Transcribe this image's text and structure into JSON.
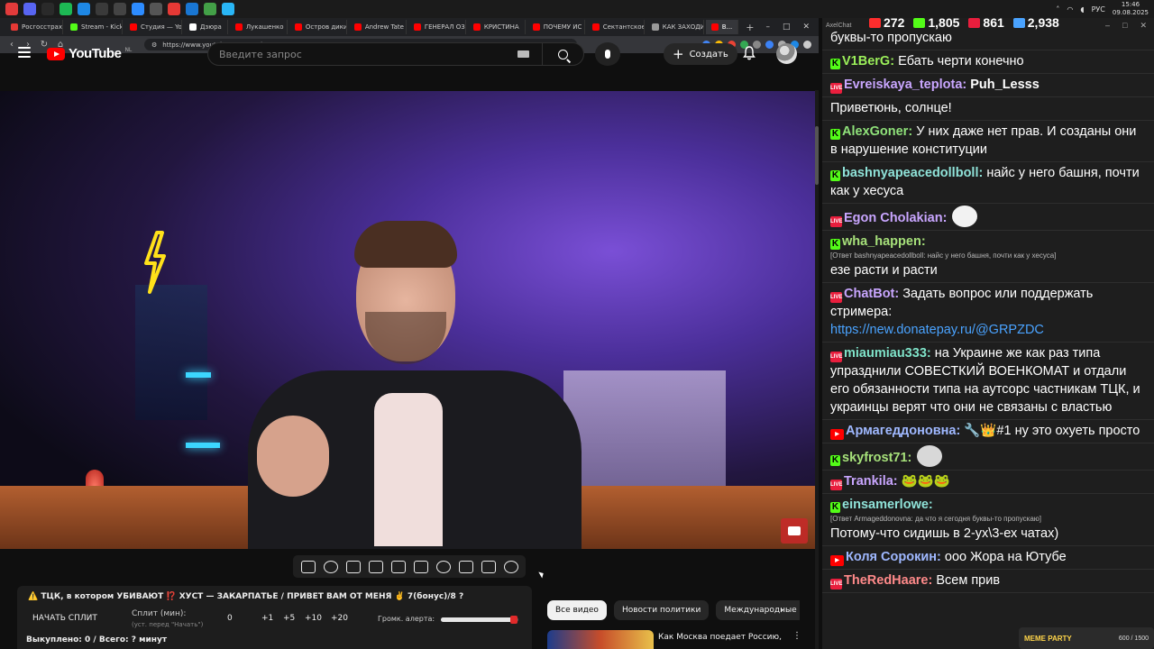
{
  "taskbar": {
    "lang": "РУС",
    "time": "15:46",
    "date": "09.08.2025",
    "icon_colors": [
      "#e23b3b",
      "#5865f2",
      "#2a2a2a",
      "#1db954",
      "#1e88e5",
      "#3a3a3a",
      "#444444",
      "#2d8cff",
      "#555555",
      "#e53935",
      "#1976d2",
      "#43a047",
      "#29b6f6"
    ]
  },
  "browser": {
    "tabs": [
      {
        "label": "Росгосстрах",
        "color": "#e53935"
      },
      {
        "label": "Stream - Kick",
        "color": "#53fc18"
      },
      {
        "label": "Студия — YouTube",
        "color": "#ff0000"
      },
      {
        "label": "Дзюра",
        "color": "#ffffff"
      },
      {
        "label": "Лукашенко",
        "color": "#ff0000"
      },
      {
        "label": "Остров дикий",
        "color": "#ff0000"
      },
      {
        "label": "Andrew Tate",
        "color": "#ff0000"
      },
      {
        "label": "ГЕНЕРАЛ ОЗ",
        "color": "#ff0000"
      },
      {
        "label": "КРИСТИНА",
        "color": "#ff0000"
      },
      {
        "label": "ПОЧЕМУ ИС",
        "color": "#ff0000"
      },
      {
        "label": "Сектантское",
        "color": "#ff0000"
      },
      {
        "label": "КАК ЗАХОДИ",
        "color": "#999999"
      },
      {
        "label": "В...",
        "color": "#ff0000"
      }
    ],
    "url": "https://www.youtube.com/watch?v=WAO4zZUwRc0"
  },
  "youtube": {
    "logo_word": "YouTube",
    "region": "NL",
    "search_placeholder": "Введите запрос",
    "create_label": "Создать"
  },
  "split": {
    "title": "⚠️ ТЦК, в котором УБИВАЮТ ⁉️ ХУСТ — ЗАКАРПАТЬЕ / ПРИВЕТ ВАМ ОТ МЕНЯ ✌️ 7(бонус)/8 ?",
    "start_label": "НАЧАТЬ СПЛИТ",
    "split_label": "Сплит (мин):",
    "split_sub": "(уст. перед \"Начать\")",
    "value": "0",
    "btn_plus1": "+1",
    "btn_plus5": "+5",
    "btn_plus10": "+10",
    "btn_plus20": "+20",
    "volume_label": "Громк. алерта:",
    "volume_fraction": 0.96,
    "footer": "Выкуплено: 0 / Всего: ? минут"
  },
  "chips": [
    "Все видео",
    "Новости политики",
    "Международные"
  ],
  "related": {
    "title": "Как Москва поедает Россию,"
  },
  "chat": {
    "title": "AxelChat",
    "stats": [
      {
        "value": "272",
        "color": "#ff2d2d"
      },
      {
        "value": "1,805",
        "color": "#53fc18"
      },
      {
        "value": "861",
        "color": "#e91e3d"
      },
      {
        "value": "2,938",
        "color": "#4aa3ff"
      }
    ],
    "messages": [
      {
        "platform": "",
        "user": "",
        "user_color": "#ffffff",
        "reply": "",
        "text": "буквы-то пропускаю",
        "link": "",
        "emote": ""
      },
      {
        "platform": "kick",
        "user": "V1BerG:",
        "user_color": "#9bef5a",
        "reply": "",
        "text": "Ебать черти конечно",
        "link": "",
        "emote": ""
      },
      {
        "platform": "live",
        "user": "Evreiskaya_teplota:",
        "user_color": "#c9a6ff",
        "reply": "",
        "text": "Puh_Lesss",
        "text_bold": true,
        "link": "",
        "emote": ""
      },
      {
        "platform": "",
        "user": "",
        "user_color": "#ffffff",
        "reply": "",
        "text": "Приветюнь, солнце!",
        "link": "",
        "emote": ""
      },
      {
        "platform": "kick",
        "user": "AlexGoner:",
        "user_color": "#8fe27a",
        "reply": "",
        "text": "У них даже нет прав. И созданы они в нарушение конституции",
        "link": "",
        "emote": ""
      },
      {
        "platform": "kick",
        "user": "bashnyapeacedollboll:",
        "user_color": "#8fe2d8",
        "reply": "",
        "text": "найс у него башня, почти как у хесуса",
        "link": "",
        "emote": ""
      },
      {
        "platform": "live",
        "user": "Egon Cholakian:",
        "user_color": "#c9a6ff",
        "reply": "",
        "text": "",
        "link": "",
        "emote": "#f2f2f2"
      },
      {
        "platform": "kick",
        "user": "wha_happen:",
        "user_color": "#a6e07a",
        "reply": "[Ответ bashnyapeacedollboll: найс у него башня, почти как у хесуса]",
        "text": "езе расти и расти",
        "link": "",
        "emote": ""
      },
      {
        "platform": "live",
        "user": "ChatBot:",
        "user_color": "#c9a6ff",
        "reply": "",
        "text": "Задать вопрос или поддержать стримера:",
        "link": "https://new.donatepay.ru/@GRPZDC",
        "emote": ""
      },
      {
        "platform": "live",
        "user": "miaumiau333:",
        "user_color": "#7fe3c9",
        "reply": "",
        "text": "на Украине же как раз типа упразднили СОВЕСТКИЙ ВОЕНКОМАТ и отдали его обязанности типа на аутсорс частникам ТЦК, и украинцы верят что они не связаны с властью",
        "link": "",
        "emote": ""
      },
      {
        "platform": "youtube",
        "user": "Армагеддоновна:",
        "user_color": "#9fb8ff",
        "reply": "",
        "text": "🔧👑#1 ну это охуеть просто",
        "link": "",
        "emote": ""
      },
      {
        "platform": "kick",
        "user": "skyfrost71:",
        "user_color": "#a6e07a",
        "reply": "",
        "text": "",
        "link": "",
        "emote": "#d8d8d8"
      },
      {
        "platform": "live",
        "user": "Trankila:",
        "user_color": "#c9a6ff",
        "reply": "",
        "text": "🐸🐸🐸",
        "link": "",
        "emote": ""
      },
      {
        "platform": "kick",
        "user": "einsamerlowe:",
        "user_color": "#8fe2d8",
        "reply": "[Ответ Armageddonovna: да что я сегодня буквы-то пропускаю]",
        "text": "Потому-что сидишь в 2-ух\\3-ех чатах)",
        "link": "",
        "emote": ""
      },
      {
        "platform": "youtube",
        "user": "Коля Сорокин:",
        "user_color": "#9fb8ff",
        "reply": "",
        "text": "ооо Жора на Ютубе",
        "link": "",
        "emote": ""
      },
      {
        "platform": "live",
        "user": "TheRedHaare:",
        "user_color": "#ff8a8a",
        "reply": "",
        "text": "Всем прив",
        "link": "",
        "emote": ""
      }
    ],
    "donate": {
      "label": "MEME PARTY",
      "progress": "600 / 1500"
    }
  }
}
